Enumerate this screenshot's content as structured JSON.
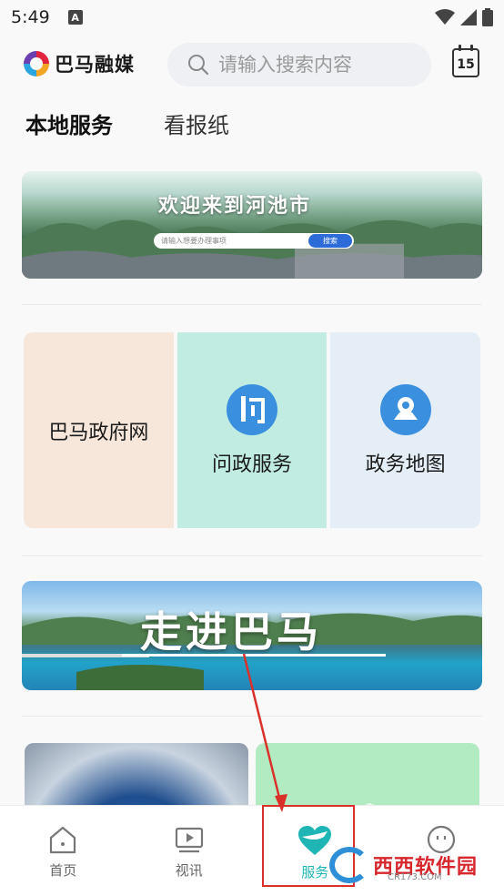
{
  "status_bar": {
    "time": "5:49",
    "notification_icon": "A"
  },
  "header": {
    "app_name": "巴马融媒",
    "search_placeholder": "请输入搜索内容",
    "calendar_day": "15"
  },
  "tabs": [
    {
      "label": "本地服务",
      "active": true
    },
    {
      "label": "看报纸",
      "active": false
    }
  ],
  "banner_top": {
    "title": "欢迎来到河池市",
    "search_placeholder": "请输入想要办理事项",
    "search_button": "搜索"
  },
  "services": [
    {
      "label": "巴马政府网",
      "icon": null
    },
    {
      "label": "问政服务",
      "icon": "ask-gov-icon"
    },
    {
      "label": "政务地图",
      "icon": "map-pin-icon"
    }
  ],
  "banner_bottom": {
    "title": "走进巴马"
  },
  "bottom_nav": [
    {
      "label": "首页",
      "icon": "home-icon",
      "active": false
    },
    {
      "label": "视讯",
      "icon": "video-icon",
      "active": false
    },
    {
      "label": "服务",
      "icon": "heart-service-icon",
      "active": true
    },
    {
      "label": "",
      "icon": "profile-icon",
      "active": false
    }
  ],
  "watermark": {
    "text": "西西软件园",
    "sub": "CR173.COM"
  },
  "colors": {
    "accent": "#1fb5b5",
    "annotation": "#d9302a",
    "service_blue": "#3a8fde"
  }
}
